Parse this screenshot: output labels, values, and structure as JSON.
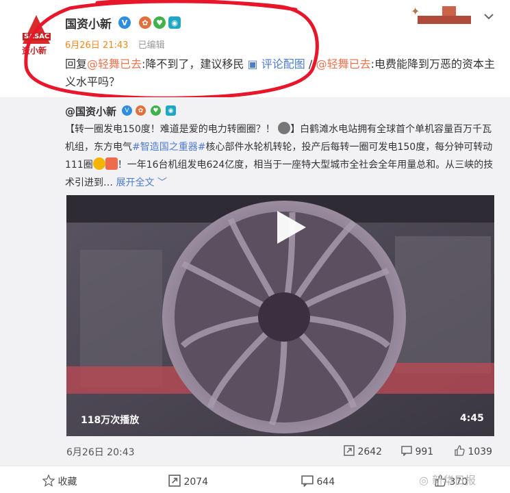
{
  "post": {
    "author": "国资小新",
    "avatar_text": "SASAC",
    "avatar_sub": "资小新",
    "time": "6月26日 21:43",
    "edited": "已编辑",
    "reply": {
      "prefix": "回复",
      "mention": "@轻舞已去",
      "text": ":降不到了，建议移民",
      "pic_label": "评论配图",
      "forward": "//",
      "mention2": "@轻舞已去",
      "text2": ":电费能降到万恶的资本主义水平吗？"
    }
  },
  "repost": {
    "author": "@国资小新",
    "text": {
      "p1": "【转一圈发电150度！难道是爱的电力转圈圈？！",
      "p2": "】白鹤滩水电站拥有全球首个单机容量百万千瓦机组，东方电气",
      "hashtag": "#智造国之重器#",
      "p3": "核心部件水轮机转轮，投产后每转一圈可发电150度，每分钟可转动111圈",
      "p4": "！一年16台机组发电624亿度，相当于一座特大型城市全社会全年用量总和。从三峡的技术引进到…",
      "expand": "展开全文"
    },
    "video": {
      "plays": "118万次播放",
      "duration": "4:45"
    },
    "date": "6月26日 20:43",
    "reposts": "2642",
    "comments": "991",
    "likes": "1039"
  },
  "footer": {
    "favorite": "收藏",
    "reposts": "2074",
    "comments": "644",
    "likes": "370"
  },
  "watermark": "新华日报",
  "colors": {
    "mention": "#eb7350",
    "link": "#4d7cd1",
    "time": "#f28a1e",
    "repost_bg": "#f2f2f5"
  }
}
